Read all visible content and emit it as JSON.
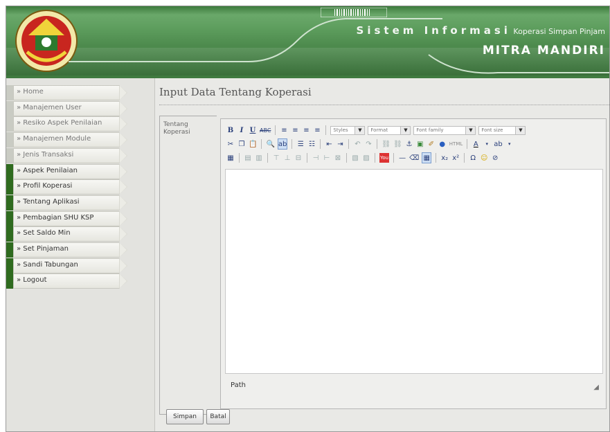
{
  "header": {
    "system_title_big": "Sistem Informasi",
    "system_title_small": "Koperasi Simpan Pinjam",
    "org_name": "MITRA MANDIRI"
  },
  "sidebar": {
    "items": [
      {
        "label": "» Home",
        "active": false
      },
      {
        "label": "» Manajemen User",
        "active": false
      },
      {
        "label": "» Resiko Aspek Penilaian",
        "active": false
      },
      {
        "label": "» Manajemen Module",
        "active": false
      },
      {
        "label": "» Jenis Transaksi",
        "active": false
      },
      {
        "label": "» Aspek Penilaian",
        "active": true
      },
      {
        "label": "» Profil Koperasi",
        "active": true
      },
      {
        "label": "» Tentang Aplikasi",
        "active": true
      },
      {
        "label": "» Pembagian SHU KSP",
        "active": true
      },
      {
        "label": "» Set Saldo Min",
        "active": true
      },
      {
        "label": "» Set Pinjaman",
        "active": true
      },
      {
        "label": "» Sandi Tabungan",
        "active": true
      },
      {
        "label": "» Logout",
        "active": true
      }
    ]
  },
  "main": {
    "page_title": "Input Data Tentang Koperasi",
    "field_label": "Tentang Koperasi",
    "editor": {
      "dropdowns": {
        "styles": "Styles",
        "format": "Format",
        "font_family": "Font family",
        "font_size": "Font size"
      },
      "status_path_label": "Path"
    },
    "buttons": {
      "save": "Simpan",
      "cancel": "Batal"
    }
  },
  "colors": {
    "header_green": "#4d8a4d",
    "active_accent": "#2f6b1f"
  }
}
